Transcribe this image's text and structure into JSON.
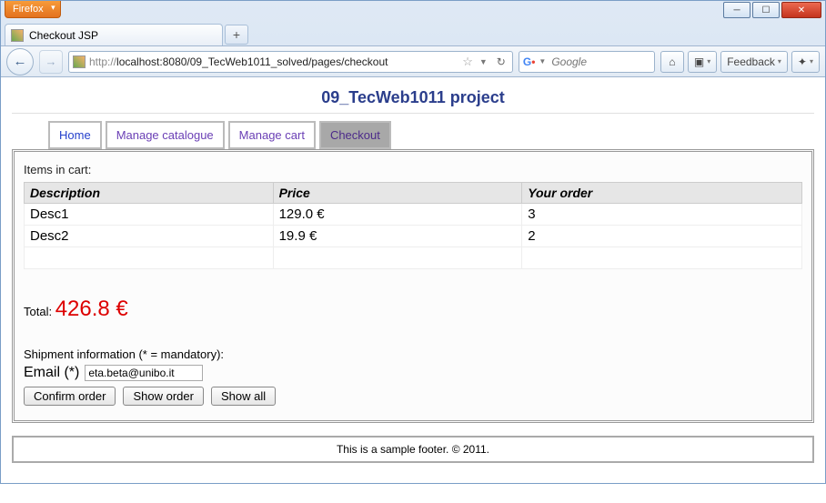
{
  "window": {
    "firefox_menu": "Firefox",
    "tab_title": "Checkout JSP",
    "url_prefix": "http://",
    "url_main": "localhost:8080/09_TecWeb1011_solved/pages/checkout",
    "search_placeholder": "Google",
    "feedback_label": "Feedback"
  },
  "page": {
    "project_title": "09_TecWeb1011 project",
    "nav": {
      "home": "Home",
      "catalogue": "Manage catalogue",
      "cart": "Manage cart",
      "checkout": "Checkout"
    },
    "items_label": "Items in cart:",
    "columns": {
      "desc": "Description",
      "price": "Price",
      "order": "Your order"
    },
    "items": [
      {
        "desc": "Desc1",
        "price": "129.0 €",
        "qty": "3"
      },
      {
        "desc": "Desc2",
        "price": "19.9 €",
        "qty": "2"
      }
    ],
    "total_label": "Total: ",
    "total_value": "426.8 €",
    "shipment_label": "Shipment information (* = mandatory):",
    "email_label": "Email (*)",
    "email_value": "eta.beta@unibo.it",
    "buttons": {
      "confirm": "Confirm order",
      "show": "Show order",
      "all": "Show all"
    },
    "footer": "This is a sample footer. © 2011."
  }
}
